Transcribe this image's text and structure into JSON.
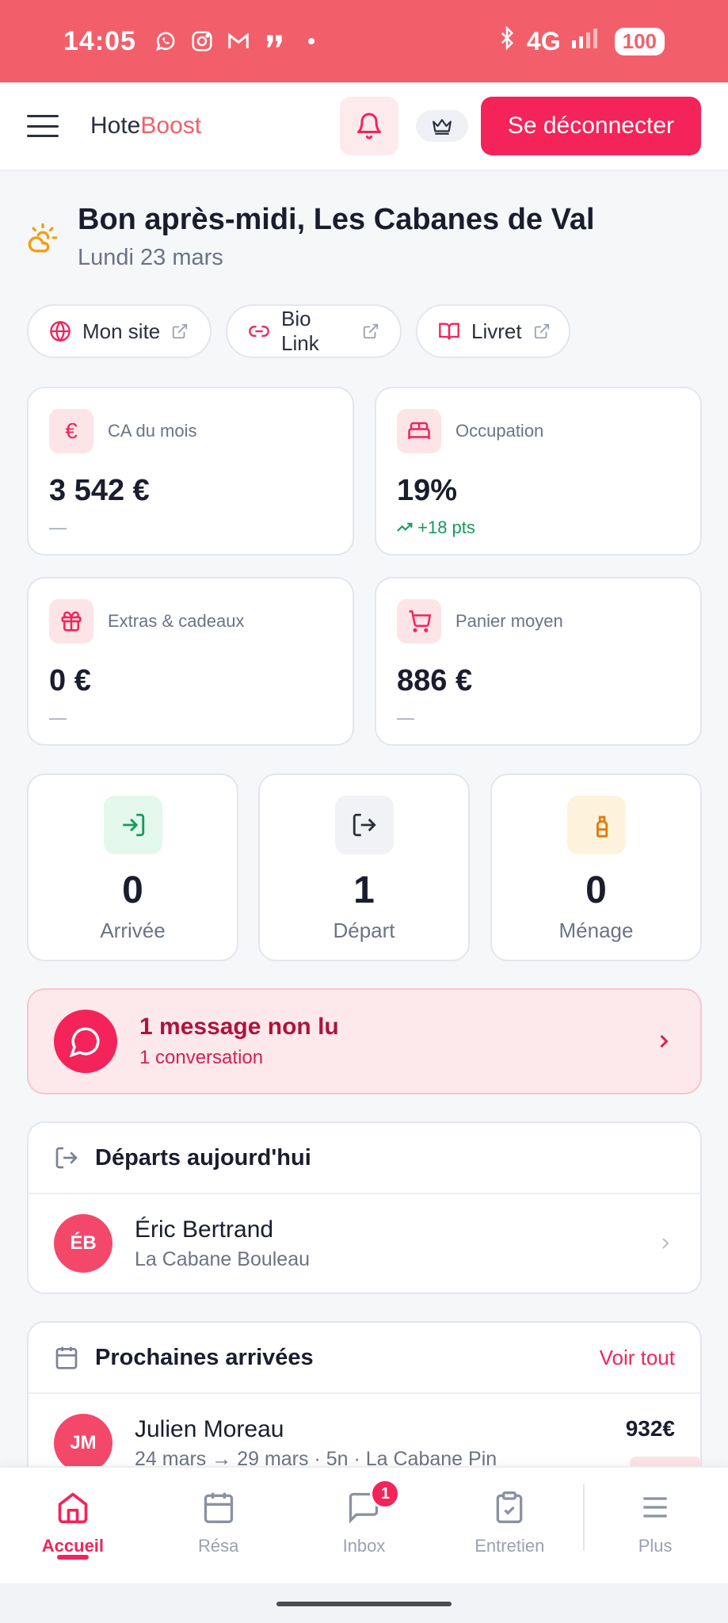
{
  "status_bar": {
    "time": "14:05",
    "network": "4G",
    "battery": "100",
    "icons": [
      "whatsapp-icon",
      "instagram-icon",
      "gmail-icon",
      "quote-app-icon",
      "dot-icon",
      "bluetooth-icon",
      "signal-icon"
    ]
  },
  "header": {
    "brand_part1": "Hote",
    "brand_part2": "Boost",
    "logout_label": "Se déconnecter",
    "brand_color": "#f25f6a",
    "accent_color": "#f4235a"
  },
  "greeting": {
    "title": "Bon après-midi, Les Cabanes de Val",
    "date": "Lundi 23 mars"
  },
  "links": [
    {
      "label": "Mon site",
      "icon": "globe-icon"
    },
    {
      "label": "Bio Link",
      "icon": "link-icon"
    },
    {
      "label": "Livret",
      "icon": "book-icon"
    }
  ],
  "stats": [
    {
      "label": "CA du mois",
      "value": "3 542 €",
      "sub": "—",
      "icon": "euro-icon"
    },
    {
      "label": "Occupation",
      "value": "19%",
      "sub": "+18 pts",
      "icon": "bed-icon"
    },
    {
      "label": "Extras & cadeaux",
      "value": "0 €",
      "sub": "—",
      "icon": "gift-icon"
    },
    {
      "label": "Panier moyen",
      "value": "886 €",
      "sub": "—",
      "icon": "cart-icon"
    }
  ],
  "counters": [
    {
      "value": "0",
      "label": "Arrivée",
      "icon": "login-icon"
    },
    {
      "value": "1",
      "label": "Départ",
      "icon": "logout-icon"
    },
    {
      "value": "0",
      "label": "Ménage",
      "icon": "spray-icon"
    }
  ],
  "messages": {
    "title": "1 message non lu",
    "sub": "1 conversation"
  },
  "departures": {
    "title": "Départs aujourd'hui",
    "items": [
      {
        "initials": "ÉB",
        "name": "Éric Bertrand",
        "place": "La Cabane Bouleau"
      }
    ]
  },
  "arrivals": {
    "title": "Prochaines arrivées",
    "see_all": "Voir tout",
    "items": [
      {
        "initials": "JM",
        "name": "Julien Moreau",
        "details": "24 mars → 29 mars · 5n · La Cabane Pin",
        "price": "932€"
      }
    ]
  },
  "bottom_nav": [
    {
      "label": "Accueil",
      "icon": "home-icon",
      "active": true
    },
    {
      "label": "Résa",
      "icon": "calendar-icon"
    },
    {
      "label": "Inbox",
      "icon": "chat-icon",
      "badge": "1"
    },
    {
      "label": "Entretien",
      "icon": "clipboard-check-icon"
    },
    {
      "label": "Plus",
      "icon": "menu-icon"
    }
  ]
}
